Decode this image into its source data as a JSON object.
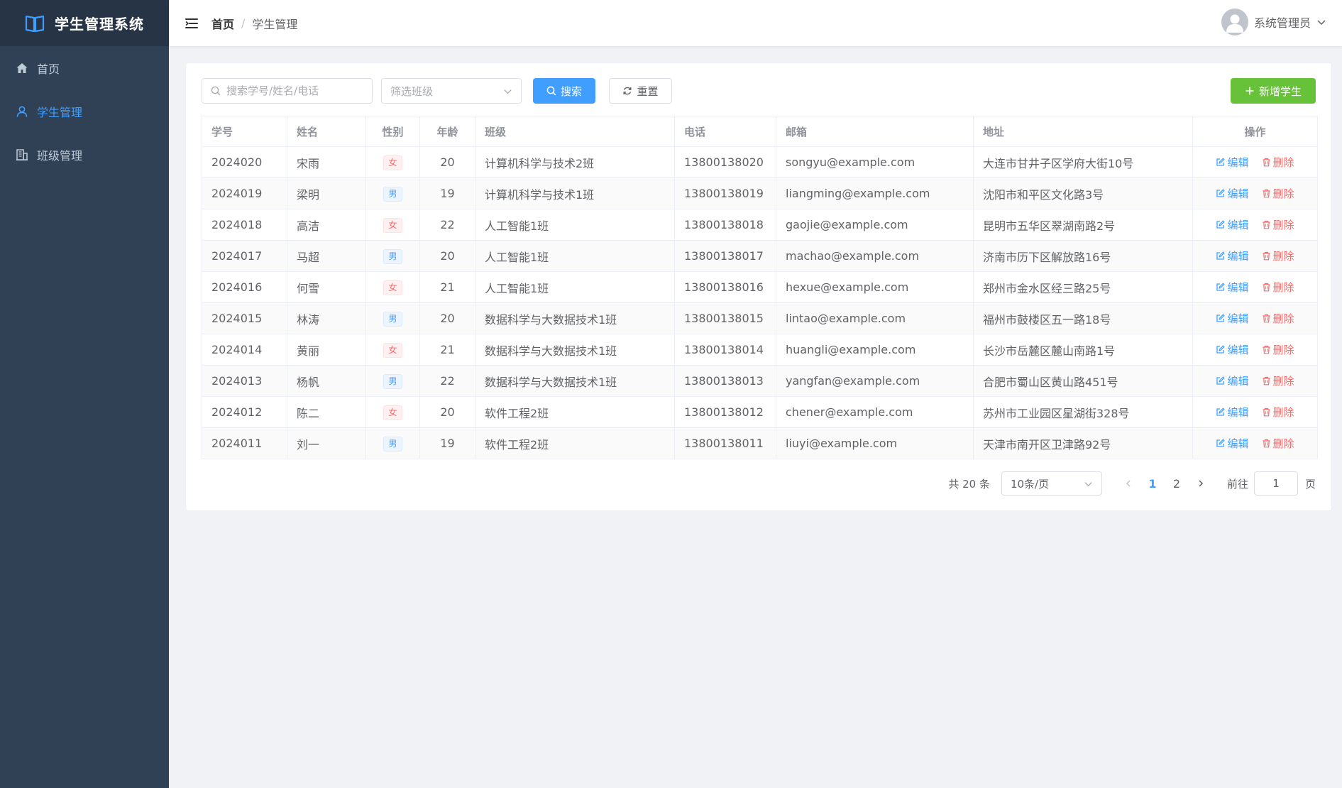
{
  "app": {
    "title": "学生管理系统"
  },
  "sidebar": {
    "items": [
      {
        "label": "首页",
        "icon": "home-icon",
        "active": false
      },
      {
        "label": "学生管理",
        "icon": "user-icon",
        "active": true
      },
      {
        "label": "班级管理",
        "icon": "building-icon",
        "active": false
      }
    ]
  },
  "header": {
    "breadcrumb": {
      "home": "首页",
      "separator": "/",
      "current": "学生管理"
    },
    "user": {
      "name": "系统管理员"
    }
  },
  "toolbar": {
    "search_placeholder": "搜索学号/姓名/电话",
    "class_filter_placeholder": "筛选班级",
    "search_label": "搜索",
    "reset_label": "重置",
    "add_label": "新增学生"
  },
  "table": {
    "columns": [
      "学号",
      "姓名",
      "性别",
      "年龄",
      "班级",
      "电话",
      "邮箱",
      "地址",
      "操作"
    ],
    "edit_label": "编辑",
    "delete_label": "删除",
    "rows": [
      {
        "id": "2024020",
        "name": "宋雨",
        "gender": "女",
        "age": "20",
        "class": "计算机科学与技术2班",
        "phone": "13800138020",
        "email": "songyu@example.com",
        "address": "大连市甘井子区学府大街10号"
      },
      {
        "id": "2024019",
        "name": "梁明",
        "gender": "男",
        "age": "19",
        "class": "计算机科学与技术1班",
        "phone": "13800138019",
        "email": "liangming@example.com",
        "address": "沈阳市和平区文化路3号"
      },
      {
        "id": "2024018",
        "name": "高洁",
        "gender": "女",
        "age": "22",
        "class": "人工智能1班",
        "phone": "13800138018",
        "email": "gaojie@example.com",
        "address": "昆明市五华区翠湖南路2号"
      },
      {
        "id": "2024017",
        "name": "马超",
        "gender": "男",
        "age": "20",
        "class": "人工智能1班",
        "phone": "13800138017",
        "email": "machao@example.com",
        "address": "济南市历下区解放路16号"
      },
      {
        "id": "2024016",
        "name": "何雪",
        "gender": "女",
        "age": "21",
        "class": "人工智能1班",
        "phone": "13800138016",
        "email": "hexue@example.com",
        "address": "郑州市金水区经三路25号"
      },
      {
        "id": "2024015",
        "name": "林涛",
        "gender": "男",
        "age": "20",
        "class": "数据科学与大数据技术1班",
        "phone": "13800138015",
        "email": "lintao@example.com",
        "address": "福州市鼓楼区五一路18号"
      },
      {
        "id": "2024014",
        "name": "黄丽",
        "gender": "女",
        "age": "21",
        "class": "数据科学与大数据技术1班",
        "phone": "13800138014",
        "email": "huangli@example.com",
        "address": "长沙市岳麓区麓山南路1号"
      },
      {
        "id": "2024013",
        "name": "杨帆",
        "gender": "男",
        "age": "22",
        "class": "数据科学与大数据技术1班",
        "phone": "13800138013",
        "email": "yangfan@example.com",
        "address": "合肥市蜀山区黄山路451号"
      },
      {
        "id": "2024012",
        "name": "陈二",
        "gender": "女",
        "age": "20",
        "class": "软件工程2班",
        "phone": "13800138012",
        "email": "chener@example.com",
        "address": "苏州市工业园区星湖街328号"
      },
      {
        "id": "2024011",
        "name": "刘一",
        "gender": "男",
        "age": "19",
        "class": "软件工程2班",
        "phone": "13800138011",
        "email": "liuyi@example.com",
        "address": "天津市南开区卫津路92号"
      }
    ]
  },
  "pagination": {
    "total_text": "共 20 条",
    "page_size": "10条/页",
    "pages": [
      "1",
      "2"
    ],
    "current_page": "1",
    "goto_label": "前往",
    "goto_value": "1",
    "goto_suffix": "页"
  },
  "colors": {
    "sidebar_bg": "#304156",
    "logo_bg": "#263445",
    "primary": "#409eff",
    "success": "#67c23a",
    "danger": "#f56c6c"
  }
}
